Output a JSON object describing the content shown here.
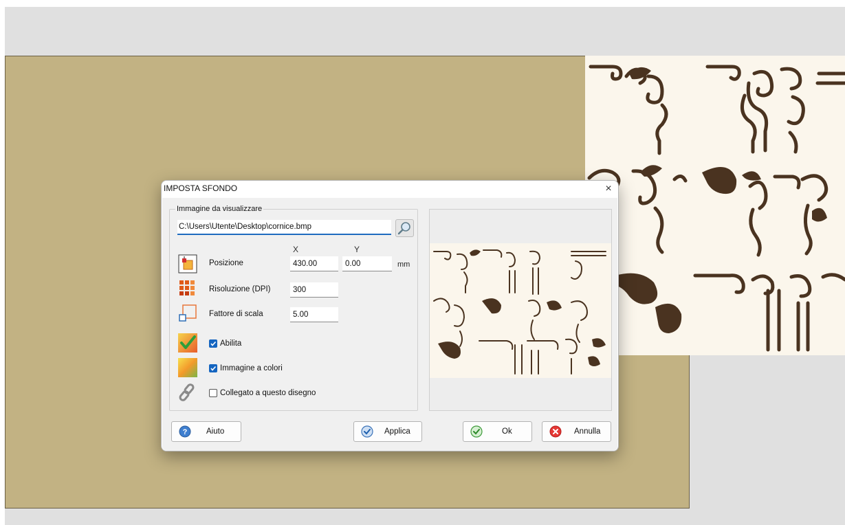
{
  "dialog": {
    "title": "IMPOSTA SFONDO",
    "close_glyph": "×",
    "group_title": "Immagine da visualizzare",
    "file_path": "C:\\Users\\Utente\\Desktop\\cornice.bmp",
    "col_x": "X",
    "col_y": "Y",
    "position": {
      "label": "Posizione",
      "x": "430.00",
      "y": "0.00",
      "unit": "mm",
      "icon": "position-icon"
    },
    "resolution": {
      "label": "Risoluzione (DPI)",
      "value": "300",
      "icon": "resolution-grid-icon"
    },
    "scale": {
      "label": "Fattore di scala",
      "value": "5.00",
      "icon": "scale-icon"
    },
    "checkboxes": {
      "enable": {
        "label": "Abilita",
        "checked": true,
        "icon": "enable-check-icon"
      },
      "color": {
        "label": "Immagine a colori",
        "checked": true,
        "icon": "color-image-icon"
      },
      "linked": {
        "label": "Collegato a questo disegno",
        "checked": false,
        "icon": "chain-link-icon"
      }
    },
    "buttons": {
      "help": "Aiuto",
      "apply": "Applica",
      "ok": "Ok",
      "cancel": "Annulla"
    }
  },
  "colors": {
    "canvas_sheet": "#c2b283",
    "ornament_ink": "#4a3320",
    "image_bg": "#fbf6ec",
    "accent": "#1565c0"
  }
}
